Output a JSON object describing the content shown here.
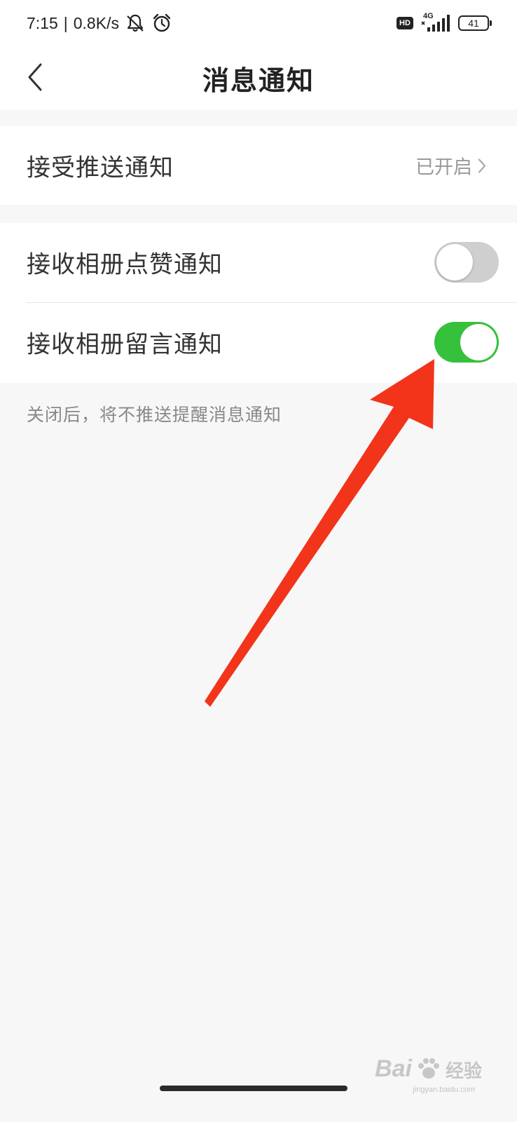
{
  "status_bar": {
    "time": "7:15",
    "net_speed": "0.8K/s",
    "network_type": "4G",
    "battery_level": "41",
    "hd_label": "HD",
    "icons": [
      "bell-muted-icon",
      "alarm-clock-icon",
      "hd-icon",
      "signal-icon",
      "battery-icon"
    ]
  },
  "header": {
    "title": "消息通知",
    "back_icon": "chevron-left-icon"
  },
  "settings": {
    "push": {
      "label": "接受推送通知",
      "value": "已开启",
      "icon": "chevron-right-icon"
    },
    "album_likes": {
      "label": "接收相册点赞通知",
      "enabled": false
    },
    "album_comments": {
      "label": "接收相册留言通知",
      "enabled": true
    }
  },
  "hint": "关闭后，将不推送提醒消息通知",
  "watermark": {
    "brand": "Bai",
    "cn": "经验",
    "url": "jingyan.baidu.com"
  },
  "colors": {
    "toggle_on": "#35c13b",
    "toggle_off": "#cfcfcf",
    "annotation_arrow": "#f2341b",
    "background": "#f7f7f7"
  }
}
